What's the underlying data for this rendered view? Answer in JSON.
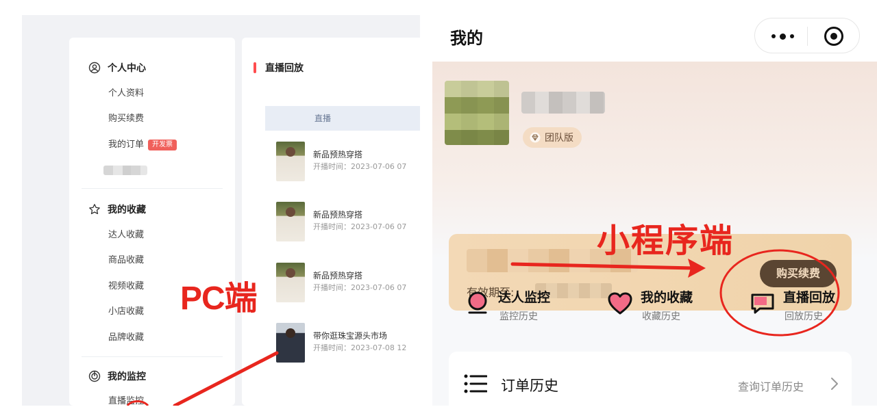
{
  "pc": {
    "sidebar": {
      "groups": [
        {
          "title": "个人中心",
          "icon": "user-circle-icon",
          "items": [
            "个人资料",
            "购买续费",
            "我的订单"
          ],
          "order_badge": "开发票"
        },
        {
          "title": "我的收藏",
          "icon": "star-icon",
          "items": [
            "达人收藏",
            "商品收藏",
            "视频收藏",
            "小店收藏",
            "品牌收藏"
          ]
        },
        {
          "title": "我的监控",
          "icon": "monitor-icon",
          "items": [
            "直播监控"
          ]
        }
      ]
    },
    "main": {
      "title": "直播回放",
      "tab_header": "直播",
      "rows": [
        {
          "title": "新品预热穿搭",
          "time": "开播时间：2023-07-06 07"
        },
        {
          "title": "新品预热穿搭",
          "time": "开播时间：2023-07-06 07"
        },
        {
          "title": "新品预热穿搭",
          "time": "开播时间：2023-07-06 07"
        },
        {
          "title": "带你逛珠宝源头市场",
          "time": "开播时间：2023-07-08 12"
        }
      ]
    },
    "annotation_label": "PC端"
  },
  "mp": {
    "nav_title": "我的",
    "badge": "团队版",
    "annotation_label": "小程序端",
    "member": {
      "valid_label": "有效期至:",
      "buy_button": "购买续费"
    },
    "features": [
      {
        "title": "达人监控",
        "sub": "监控历史",
        "icon": "monitor-icon"
      },
      {
        "title": "我的收藏",
        "sub": "收藏历史",
        "icon": "heart-icon"
      },
      {
        "title": "直播回放",
        "sub": "回放历史",
        "icon": "chat-bubble-icon"
      }
    ],
    "order": {
      "title": "订单历史",
      "link": "查询订单历史"
    }
  },
  "colors": {
    "annotation_red": "#e8261e",
    "accent_red": "#ff4d4f",
    "gold_button": "#5a4532"
  }
}
